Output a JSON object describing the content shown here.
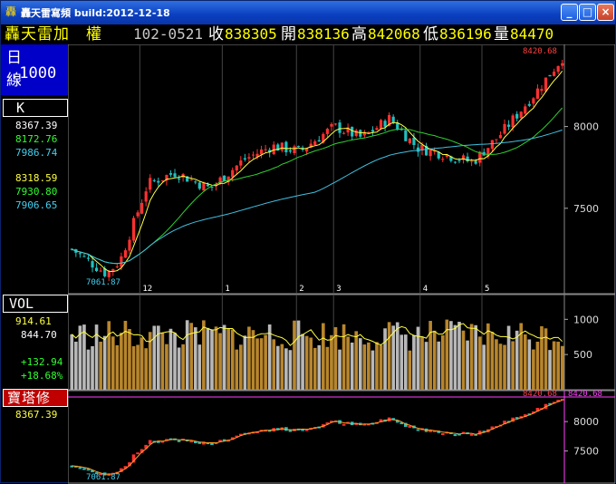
{
  "window": {
    "title": "轟天雷寫頻 build:2012-12-18",
    "buttons": [
      "_",
      "□",
      "×"
    ]
  },
  "header": {
    "name": "轟天雷加　權",
    "date": "102-0521",
    "close_label": "收",
    "close": "838305",
    "open_label": "開",
    "open": "838136",
    "high_label": "高",
    "high": "842068",
    "low_label": "低",
    "low": "836196",
    "vol_label": "量",
    "vol": "84470"
  },
  "left": {
    "period": "日　線",
    "interval": ".1000",
    "k_label": "K",
    "k_values": [
      "8367.39",
      "8172.76",
      "7986.74"
    ],
    "k_values2": [
      "8318.59",
      "7930.80",
      "7906.65"
    ],
    "vol_label": "VOL",
    "vol_values": [
      "914.61",
      "844.70"
    ],
    "vol_change": [
      "+132.94",
      "+18.68%"
    ],
    "bt_label": "寶塔修",
    "bt_value": "8367.39"
  },
  "chart_data": [
    {
      "type": "candlestick",
      "name": "k-chart",
      "yticks": [
        7500,
        8000
      ],
      "ylim": [
        7000,
        8480
      ],
      "months": [
        "12",
        "1",
        "2",
        "3",
        "4",
        "5"
      ],
      "max_label": "8420.68",
      "min_label": "7061.87"
    },
    {
      "type": "bar",
      "name": "volume",
      "yticks": [
        500,
        1000
      ],
      "ylim": [
        0,
        1300
      ]
    },
    {
      "type": "line",
      "name": "tower",
      "yticks": [
        7500,
        8000
      ],
      "ylim": [
        7000,
        8480
      ],
      "max_label": "8420.68",
      "min_label": "7061.87"
    }
  ],
  "colors": {
    "up": "#ff3030",
    "down": "#20c0c0",
    "vol_up": "#b8862c",
    "vol_down": "#b8b8b8",
    "ma1": "#ffff40",
    "ma2": "#30d030",
    "ma3": "#40c0e0"
  }
}
